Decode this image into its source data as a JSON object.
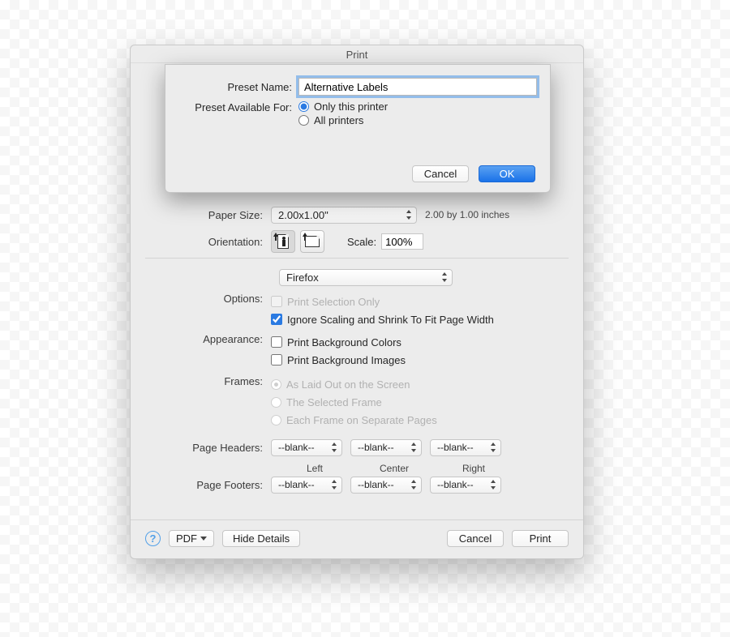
{
  "window": {
    "title": "Print"
  },
  "sheet": {
    "preset_name_label": "Preset Name:",
    "preset_name_value": "Alternative Labels",
    "available_for_label": "Preset Available For:",
    "only_this_printer": "Only this printer",
    "all_printers": "All printers",
    "cancel": "Cancel",
    "ok": "OK"
  },
  "paper": {
    "label": "Paper Size:",
    "value": "2.00x1.00\"",
    "note": "2.00 by 1.00 inches"
  },
  "orientation": {
    "label": "Orientation:",
    "scale_label": "Scale:",
    "scale_value": "100%"
  },
  "app_select": "Firefox",
  "options": {
    "label": "Options:",
    "print_selection": "Print Selection Only",
    "ignore_scaling": "Ignore Scaling and Shrink To Fit Page Width"
  },
  "appearance": {
    "label": "Appearance:",
    "bg_colors": "Print Background Colors",
    "bg_images": "Print Background Images"
  },
  "frames": {
    "label": "Frames:",
    "as_laid_out": "As Laid Out on the Screen",
    "selected": "The Selected Frame",
    "each": "Each Frame on Separate Pages"
  },
  "headers_row_label": "Page Headers:",
  "footers_row_label": "Page Footers:",
  "blank": "--blank--",
  "legend": {
    "left": "Left",
    "center": "Center",
    "right": "Right"
  },
  "bottom": {
    "pdf": "PDF",
    "hide_details": "Hide Details",
    "cancel": "Cancel",
    "print": "Print"
  }
}
